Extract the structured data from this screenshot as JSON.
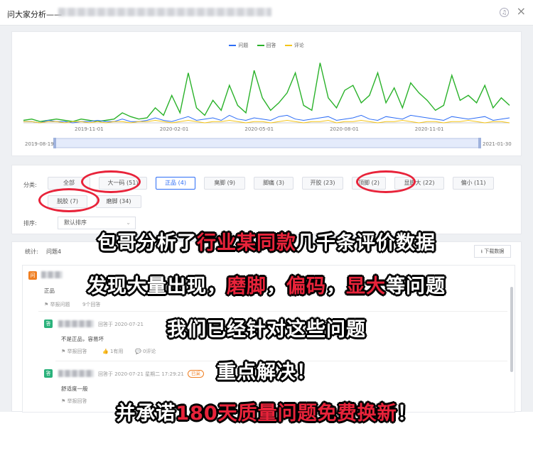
{
  "window": {
    "title": "问大家分析——"
  },
  "colors": {
    "question": "#2d6df6",
    "answer": "#2ab22a",
    "comment": "#f5c518",
    "accent": "#e8233a"
  },
  "chart_data": {
    "type": "line",
    "legend": [
      "问题",
      "回答",
      "评论"
    ],
    "x_ticks": [
      "2019-11-01",
      "2020-02-01",
      "2020-05-01",
      "2020-08-01",
      "2020-11-01"
    ],
    "range": {
      "start": "2019-08-19",
      "end": "2021-01-30"
    },
    "series": [
      {
        "name": "问题",
        "values": [
          1,
          1,
          0,
          2,
          1,
          1,
          0,
          1,
          1,
          2,
          1,
          1,
          3,
          1,
          1,
          2,
          4,
          2,
          1,
          3,
          5,
          2,
          3,
          4,
          2,
          6,
          3,
          2,
          4,
          3,
          2,
          5,
          6,
          3,
          2,
          3,
          4,
          5,
          2,
          3,
          4,
          6,
          3,
          2,
          5,
          4,
          3,
          6,
          5,
          4,
          3,
          2,
          5,
          4,
          3,
          4,
          5,
          2,
          3,
          4
        ]
      },
      {
        "name": "回答",
        "values": [
          2,
          3,
          1,
          2,
          3,
          2,
          1,
          3,
          2,
          1,
          2,
          3,
          8,
          5,
          3,
          4,
          12,
          6,
          22,
          8,
          40,
          12,
          6,
          18,
          10,
          30,
          14,
          8,
          42,
          20,
          10,
          16,
          24,
          40,
          14,
          10,
          48,
          20,
          12,
          26,
          30,
          16,
          22,
          40,
          16,
          28,
          12,
          32,
          24,
          18,
          10,
          14,
          38,
          18,
          22,
          16,
          30,
          12,
          20,
          14
        ]
      },
      {
        "name": "评论",
        "values": [
          1,
          1,
          0,
          1,
          1,
          0,
          1,
          1,
          0,
          1,
          0,
          1,
          1,
          0,
          1,
          1,
          2,
          1,
          0,
          1,
          2,
          1,
          0,
          1,
          1,
          2,
          1,
          0,
          1,
          1,
          0,
          1,
          2,
          1,
          0,
          1,
          1,
          2,
          0,
          1,
          1,
          2,
          1,
          0,
          1,
          1,
          2,
          1,
          0,
          1,
          1,
          0,
          1,
          1,
          2,
          1,
          0,
          1,
          1,
          0
        ]
      }
    ]
  },
  "filters": {
    "category_label": "分类:",
    "categories": [
      "全部",
      "大一码 (51)",
      "正品 (4)",
      "臭脚 (9)",
      "脚痛 (3)",
      "开胶 (23)",
      "顶脚 (2)",
      "显脚大 (22)",
      "偏小 (11)",
      "脱胶 (7)",
      "磨脚 (34)"
    ],
    "sort_label": "排序:",
    "sort_value": "默认排序"
  },
  "list": {
    "stat_label": "统计:",
    "stat_value": "问题4",
    "download_label": "下载数据",
    "question": {
      "badge": "问",
      "text": "正品",
      "report": "举报问题",
      "answers": "9个回答"
    },
    "answers": [
      {
        "badge": "答",
        "date": "回答于 2020-07-21",
        "text": "不是正品，容易坏",
        "report": "举报回答",
        "useful": "1有用",
        "comments": "0评论",
        "adopted": ""
      },
      {
        "badge": "答",
        "date": "回答于 2020-07-21 星期二 17:29:21",
        "text": "舒适度一般",
        "report": "举报回答",
        "useful": "",
        "comments": "",
        "adopted": "已采"
      }
    ]
  },
  "overlay": {
    "line1": {
      "a": "包哥分析了",
      "b": "行业某同款",
      "c": "几千条评价数据"
    },
    "line2": {
      "a": "发现大量出现，",
      "b": "磨脚",
      "c": "，",
      "d": "偏码",
      "e": "，",
      "f": "显大",
      "g": "等问题"
    },
    "line3": "我们已经针对这些问题",
    "line4": "重点解决！",
    "line5": {
      "a": "并承诺",
      "b": "180天质量问题免费换新",
      "c": "！"
    }
  }
}
